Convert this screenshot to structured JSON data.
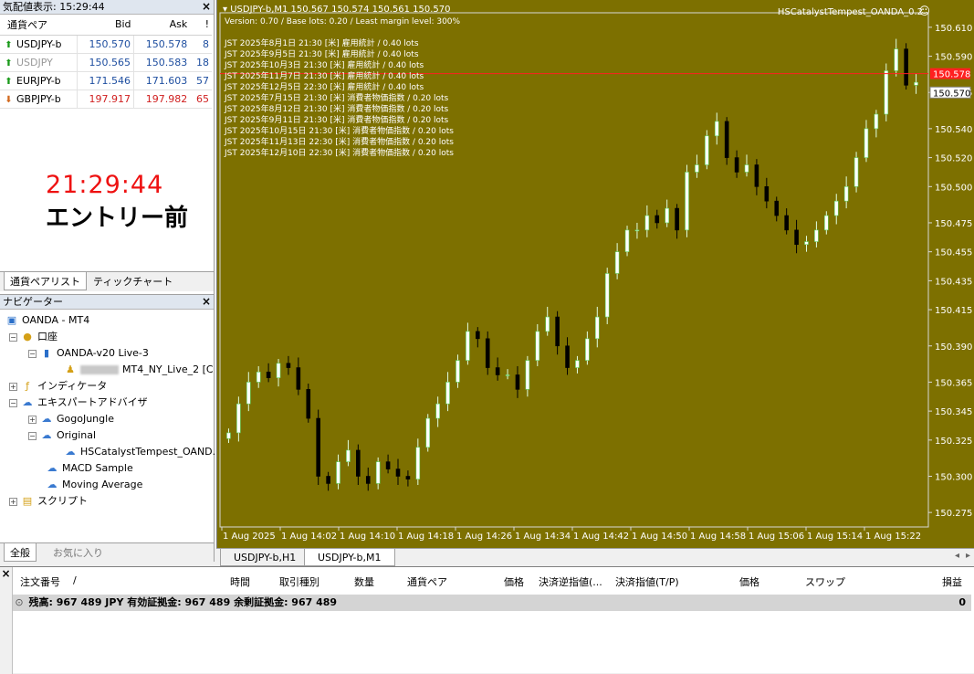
{
  "market_watch": {
    "title": "気配値表示: 15:29:44",
    "columns": {
      "symbol": "通貨ペア",
      "bid": "Bid",
      "ask": "Ask",
      "spread": "!"
    },
    "rows": [
      {
        "symbol": "USDJPY-b",
        "bid": "150.570",
        "ask": "150.578",
        "spread": "8",
        "dir": "up"
      },
      {
        "symbol": "USDJPY",
        "bid": "150.565",
        "ask": "150.583",
        "spread": "18",
        "dir": "up"
      },
      {
        "symbol": "EURJPY-b",
        "bid": "171.546",
        "ask": "171.603",
        "spread": "57",
        "dir": "up"
      },
      {
        "symbol": "GBPJPY-b",
        "bid": "197.917",
        "ask": "197.982",
        "spread": "65",
        "dir": "down"
      }
    ],
    "overlay_time": "21:29:44",
    "overlay_text": "エントリー前",
    "tab_symbols": "通貨ペアリスト",
    "tab_tick": "ティックチャート"
  },
  "navigator": {
    "title": "ナビゲーター",
    "root": "OANDA - MT4",
    "accounts": "口座",
    "server": "OANDA-v20 Live-3",
    "account_name": "MT4_NY_Live_2 [C",
    "indicators": "インディケータ",
    "experts": "エキスパートアドバイザ",
    "gogojungle": "GogoJungle",
    "original": "Original",
    "ea_name": "HSCatalystTempest_OAND...",
    "macd": "MACD Sample",
    "ma": "Moving Average",
    "scripts": "スクリプト",
    "tab_all": "全般",
    "tab_fav": "お気に入り"
  },
  "chart": {
    "header": "USDJPY-b,M1  150.567 150.574 150.561 150.570",
    "subheader": "Version: 0.70 / Base lots: 0.20 / Least margin level: 300%",
    "ea_label": "HSCatalystTempest_OANDA_0.2",
    "news": [
      "JST 2025年8月1日 21:30 [米] 雇用統計 / 0.40 lots",
      "JST 2025年9月5日 21:30 [米] 雇用統計 / 0.40 lots",
      "JST 2025年10月3日 21:30 [米] 雇用統計 / 0.40 lots",
      "JST 2025年11月7日 21:30 [米] 雇用統計 / 0.40 lots",
      "JST 2025年12月5日 22:30 [米] 雇用統計 / 0.40 lots",
      "JST 2025年7月15日 21:30 [米] 消費者物価指数 / 0.20 lots",
      "JST 2025年8月12日 21:30 [米] 消費者物価指数 / 0.20 lots",
      "JST 2025年9月11日 21:30 [米] 消費者物価指数 / 0.20 lots",
      "JST 2025年10月15日 21:30 [米] 消費者物価指数 / 0.20 lots",
      "JST 2025年11月13日 22:30 [米] 消費者物価指数 / 0.20 lots",
      "JST 2025年12月10日 22:30 [米] 消費者物価指数 / 0.20 lots"
    ],
    "ask_label": "150.578",
    "bid_label": "150.570",
    "y_ticks": [
      "150.610",
      "150.590",
      "150.565",
      "150.540",
      "150.520",
      "150.500",
      "150.475",
      "150.455",
      "150.435",
      "150.415",
      "150.390",
      "150.365",
      "150.345",
      "150.325",
      "150.300",
      "150.275"
    ],
    "x_ticks": [
      "1 Aug 2025",
      "1 Aug 14:02",
      "1 Aug 14:10",
      "1 Aug 14:18",
      "1 Aug 14:26",
      "1 Aug 14:34",
      "1 Aug 14:42",
      "1 Aug 14:50",
      "1 Aug 14:58",
      "1 Aug 15:06",
      "1 Aug 15:14",
      "1 Aug 15:22"
    ],
    "tab1": "USDJPY-b,H1",
    "tab2": "USDJPY-b,M1"
  },
  "terminal": {
    "cols": [
      "注文番号",
      "/",
      "時間",
      "取引種別",
      "数量",
      "通貨ペア",
      "価格",
      "決済逆指値(...",
      "決済指値(T/P)",
      "価格",
      "スワップ",
      "損益"
    ],
    "balance": "残高: 967 489 JPY  有効証拠金: 967 489  余剰証拠金: 967 489",
    "profit": "0"
  },
  "colors": {
    "chart_bg": "#7d7000",
    "bull": "#ffffff",
    "bear": "#000000",
    "ask_line": "#ff2020"
  }
}
